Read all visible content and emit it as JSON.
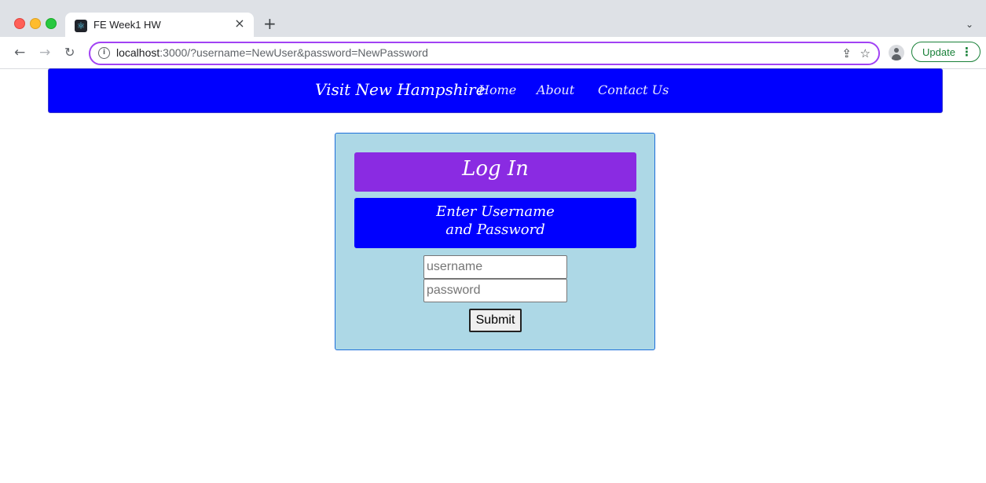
{
  "browser": {
    "tab_title": "FE Week1 HW",
    "tab_close": "×",
    "new_tab": "+",
    "tab_menu": "⌄",
    "url_host": "localhost",
    "url_rest": ":3000/?username=NewUser&password=NewPassword",
    "update_label": "Update",
    "icons": {
      "back": "arrow-left-icon",
      "forward": "arrow-right-icon",
      "reload": "reload-icon",
      "info": "info-icon",
      "share": "share-icon",
      "star": "star-icon",
      "profile": "profile-icon",
      "more": "more-vertical-icon"
    }
  },
  "navbar": {
    "brand": "Visit New Hampshire",
    "links": [
      "Home",
      "About",
      "Contact Us"
    ],
    "background": "#0000ff"
  },
  "login": {
    "heading": "Log In",
    "subheading": "Enter Username and Password",
    "username_placeholder": "username",
    "password_placeholder": "password",
    "submit_label": "Submit",
    "colors": {
      "card_bg": "#add8e6",
      "heading_bg": "#8a2be2",
      "subheading_bg": "#0000ff"
    }
  }
}
